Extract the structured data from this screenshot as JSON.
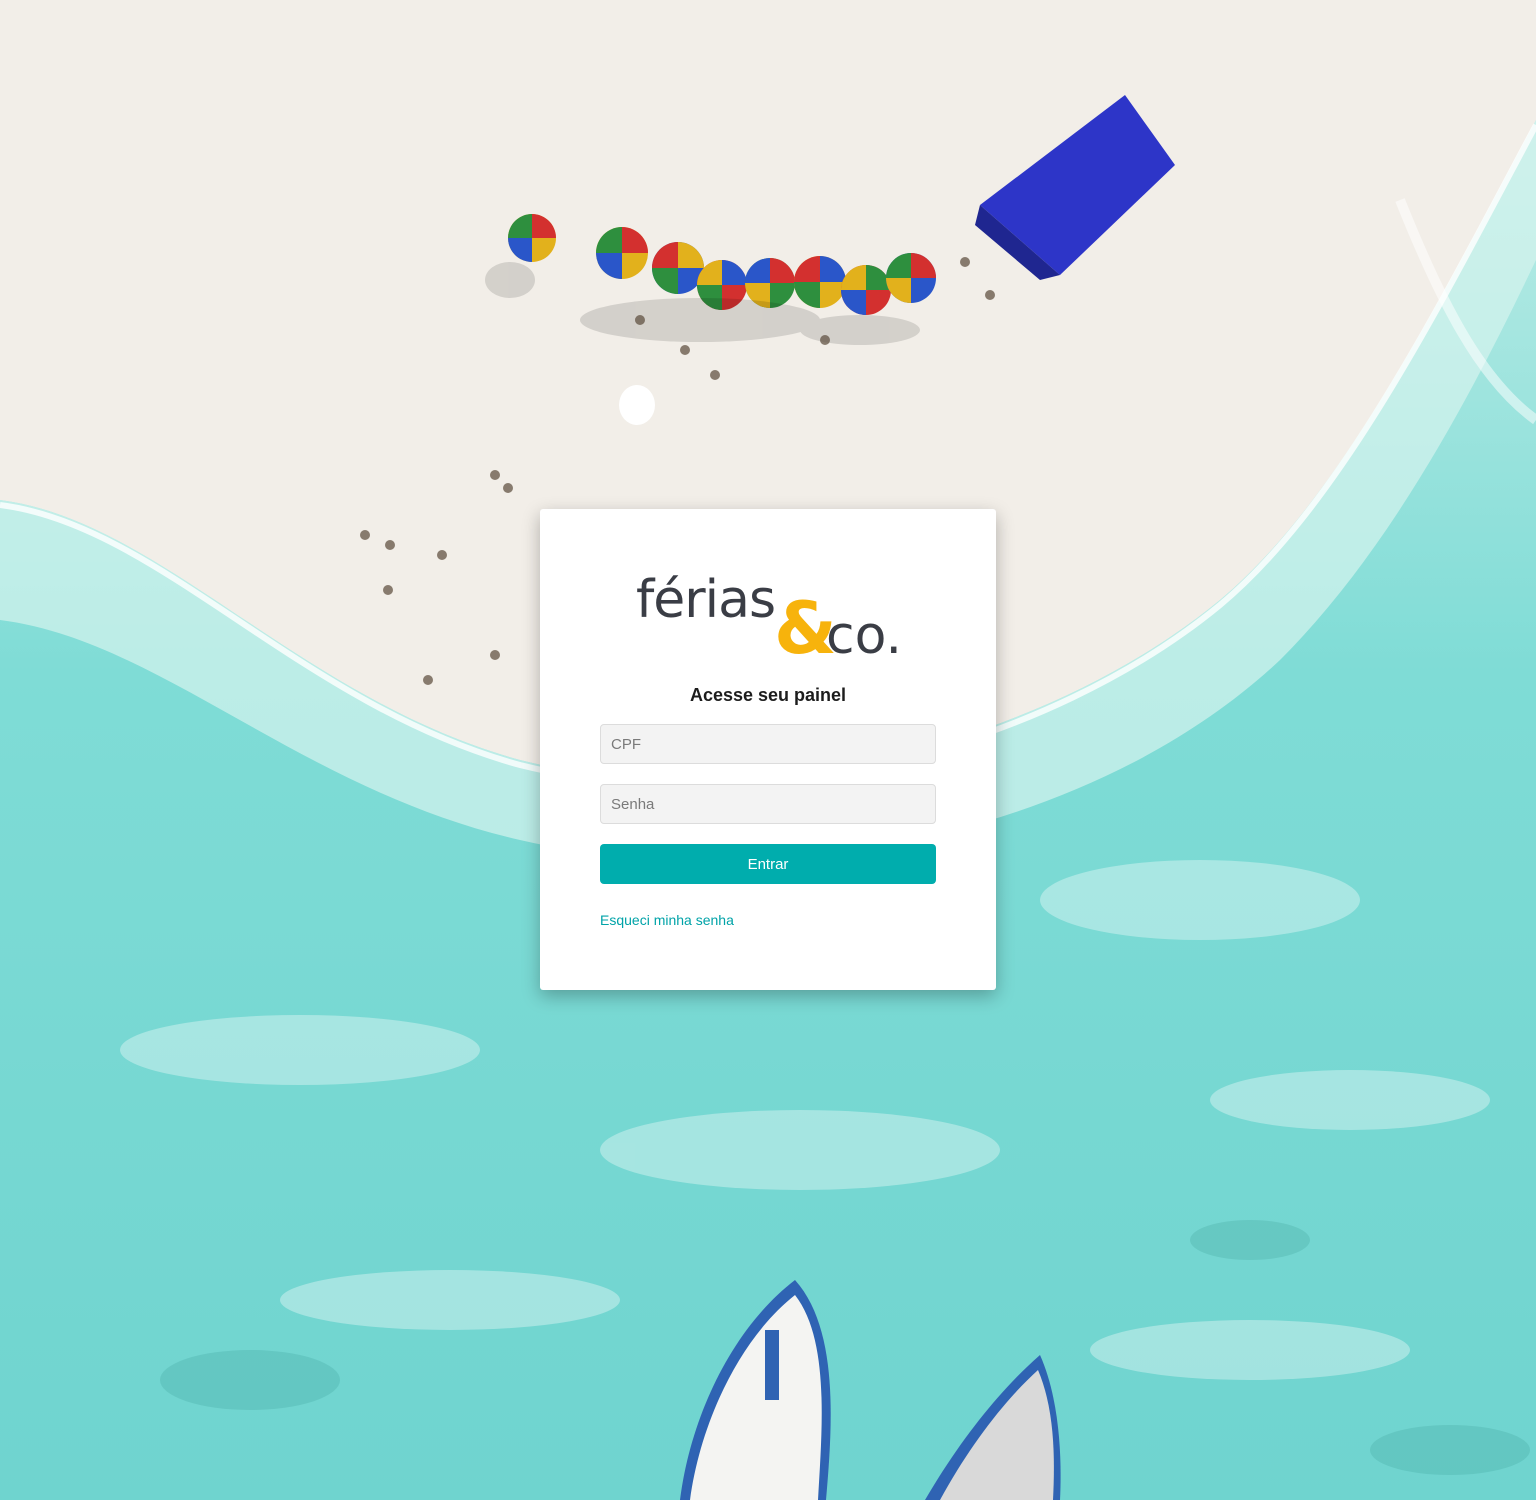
{
  "brand": {
    "logo_word": "férias",
    "logo_amp": "&",
    "logo_suffix": "co.",
    "dark_color": "#3a3d45",
    "accent_color": "#f7b30c"
  },
  "login": {
    "heading": "Acesse seu painel",
    "cpf_placeholder": "CPF",
    "senha_placeholder": "Senha",
    "submit_label": "Entrar",
    "forgot_label": "Esqueci minha senha",
    "button_color": "#00adad",
    "link_color": "#00a3a8"
  },
  "background": {
    "scene": "aerial-beach-photo"
  }
}
